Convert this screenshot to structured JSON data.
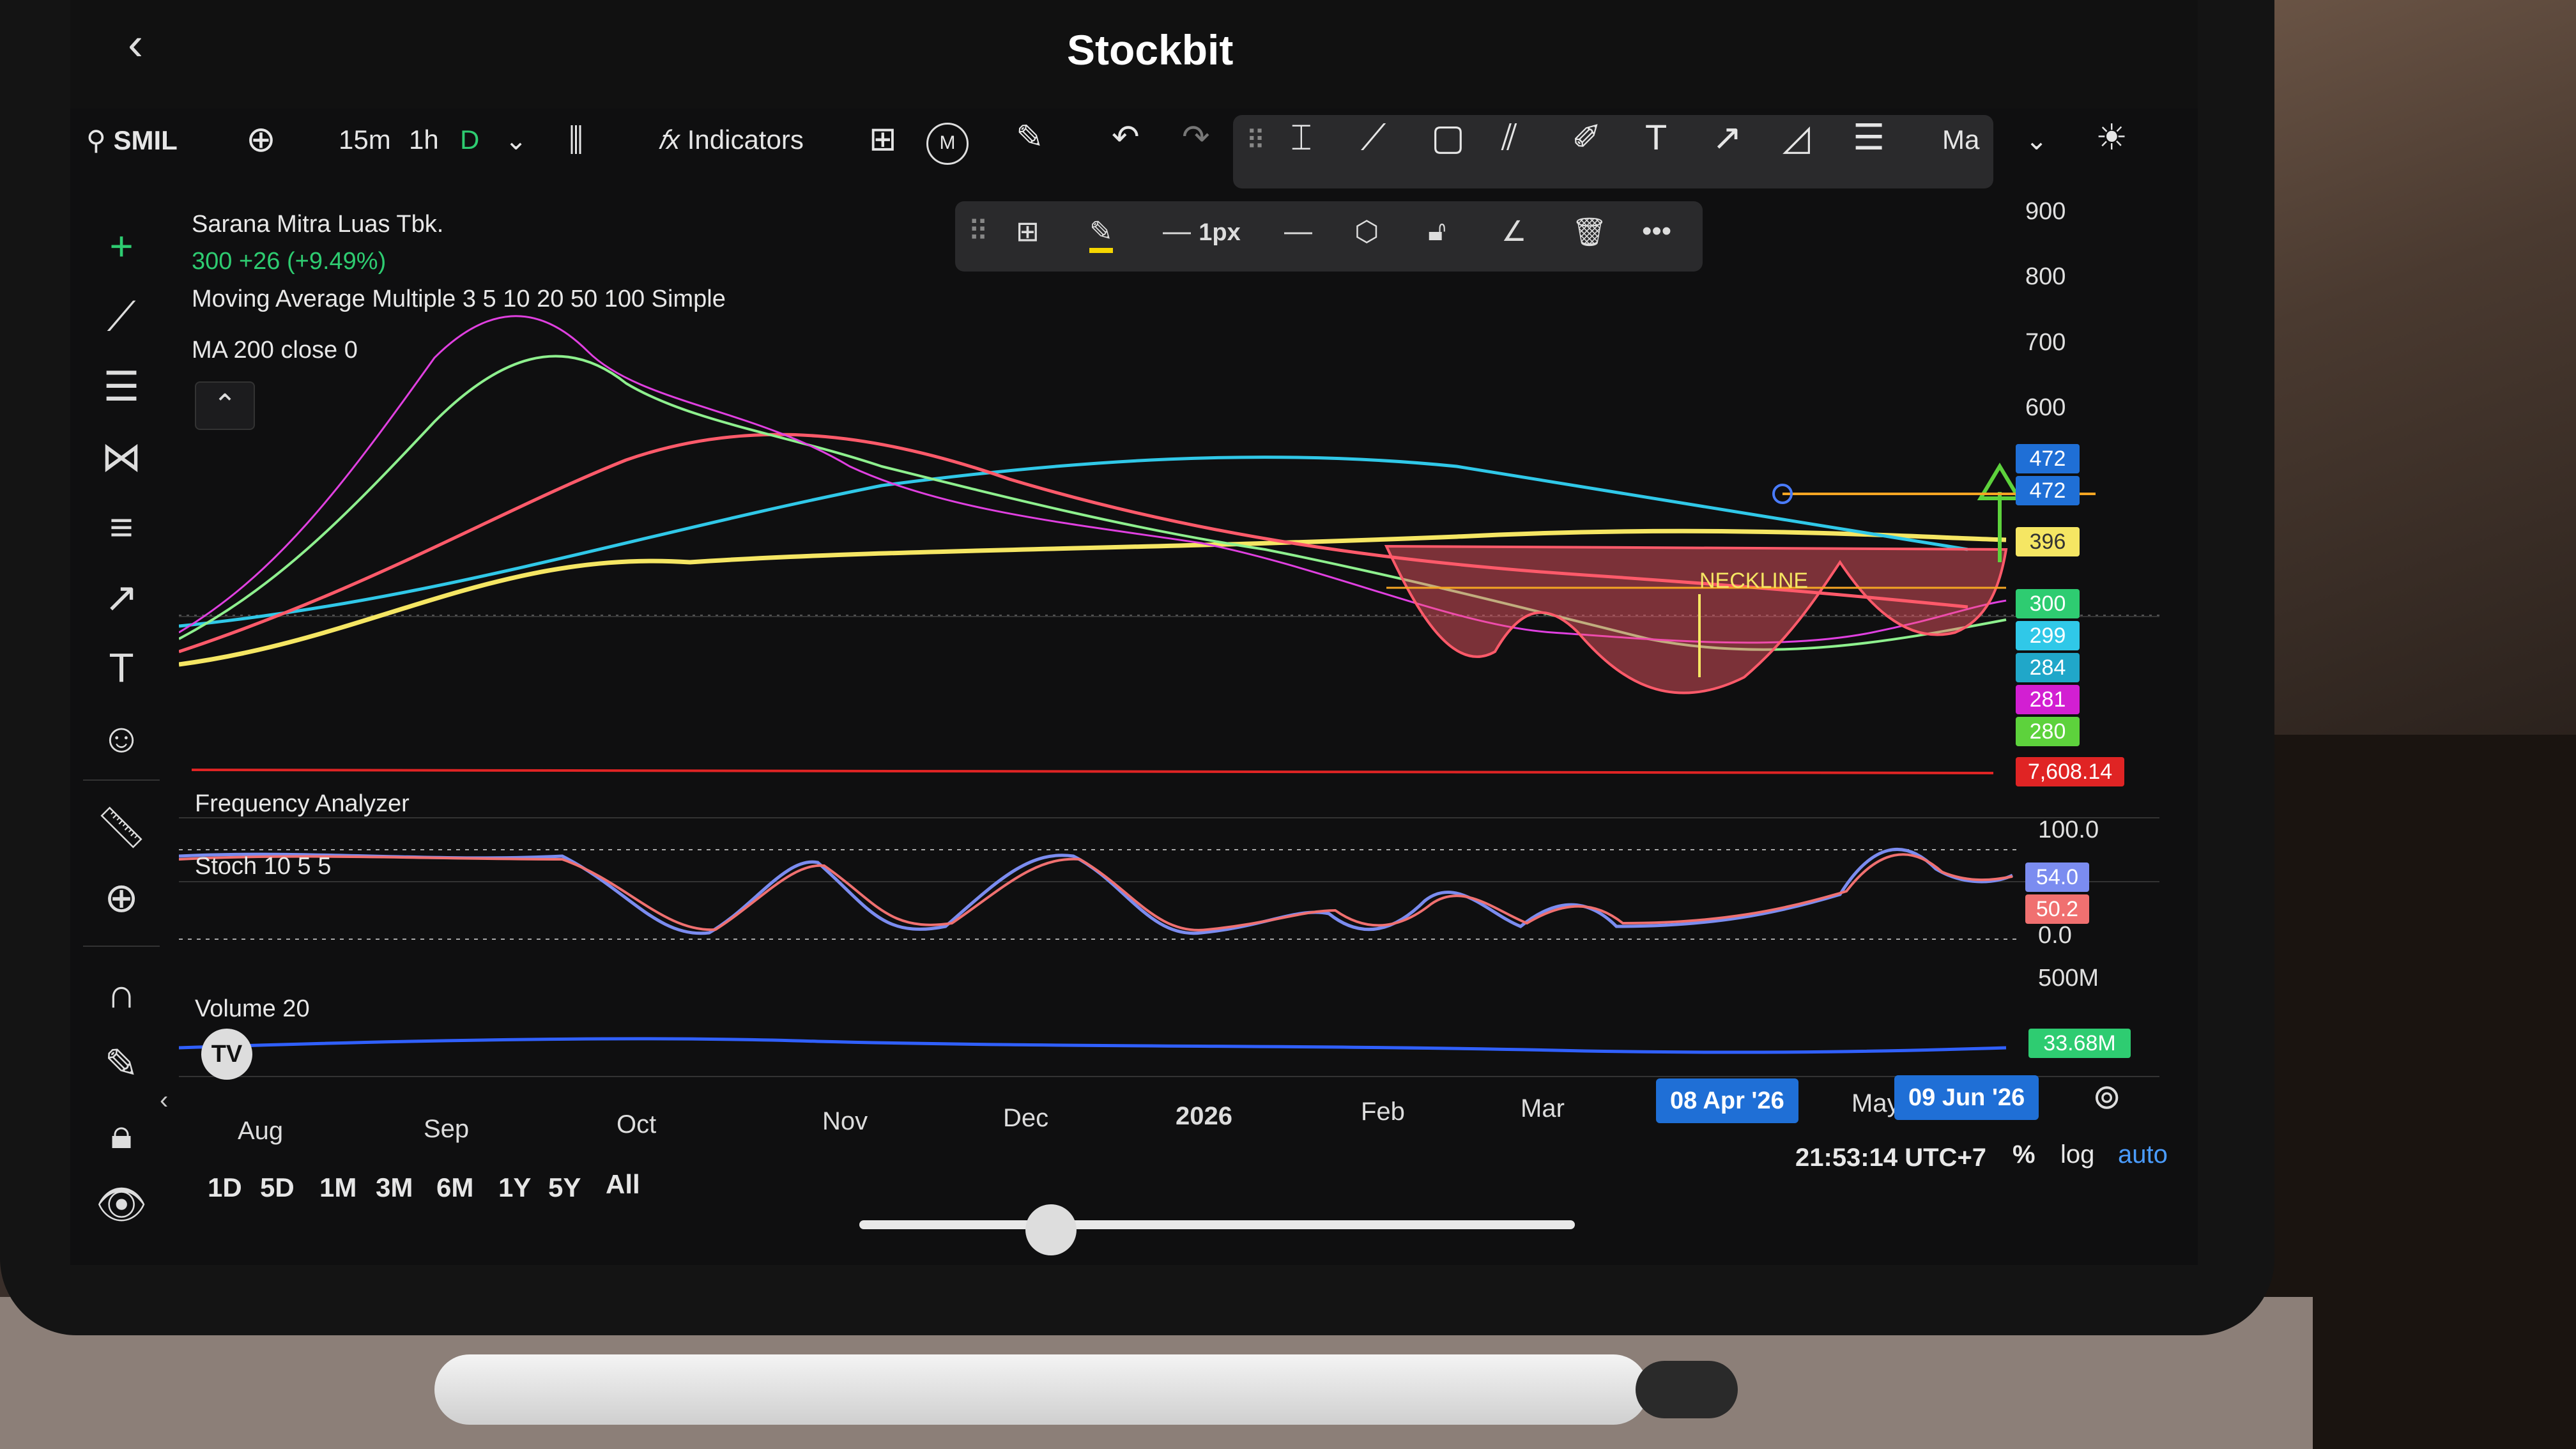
{
  "app": {
    "title": "Stockbit"
  },
  "toolbar": {
    "symbol": "SMIL",
    "intervals": [
      "15m",
      "1h",
      "D"
    ],
    "indicators_label": "Indicators",
    "m_badge": "M",
    "ma_label": "Ma",
    "stroke_width": "1px"
  },
  "instrument": {
    "name": "Sarana Mitra Luas Tbk.",
    "quote": "300  +26 (+9.49%)",
    "indicator1": "Moving Average Multiple 3 5 10 20 50 100 Simple",
    "indicator2": "MA 200 close 0"
  },
  "price_axis": [
    "900",
    "800",
    "700",
    "600"
  ],
  "price_tags": [
    {
      "value": "472",
      "color": "#1f6fd6"
    },
    {
      "value": "472",
      "color": "#1f6fd6"
    },
    {
      "value": "396",
      "color": "#f5e663"
    },
    {
      "value": "300",
      "color": "#2ecc71"
    },
    {
      "value": "299",
      "color": "#30c8e8"
    },
    {
      "value": "284",
      "color": "#20a7c9"
    },
    {
      "value": "281",
      "color": "#d21fd2"
    },
    {
      "value": "280",
      "color": "#5dd23c"
    },
    {
      "value": "7,608.14",
      "color": "#e02424"
    }
  ],
  "annotation": {
    "neckline": "NECKLINE"
  },
  "panels": {
    "freq": "Frequency Analyzer",
    "stoch": "Stoch 10 5 5",
    "stoch_axis": [
      "100.0",
      "0.0"
    ],
    "stoch_tags": [
      {
        "value": "54.0",
        "color": "#7b8cf0"
      },
      {
        "value": "50.2",
        "color": "#f07070"
      }
    ],
    "volume": "Volume 20",
    "volume_axis": "500M",
    "volume_tag": "33.68M"
  },
  "time_axis": [
    "Aug",
    "Sep",
    "Oct",
    "Nov",
    "Dec",
    "2026",
    "Feb",
    "Mar",
    "May"
  ],
  "date_pills": [
    "08 Apr '26",
    "09 Jun '26"
  ],
  "ranges": [
    "1D",
    "5D",
    "1M",
    "3M",
    "6M",
    "1Y",
    "5Y",
    "All"
  ],
  "footer": {
    "clock": "21:53:14 UTC+7",
    "percent": "%",
    "log": "log",
    "auto": "auto"
  },
  "colors": {
    "up": "#2ecc71",
    "down": "#ff5a6a",
    "accent": "#1f6fd6"
  }
}
